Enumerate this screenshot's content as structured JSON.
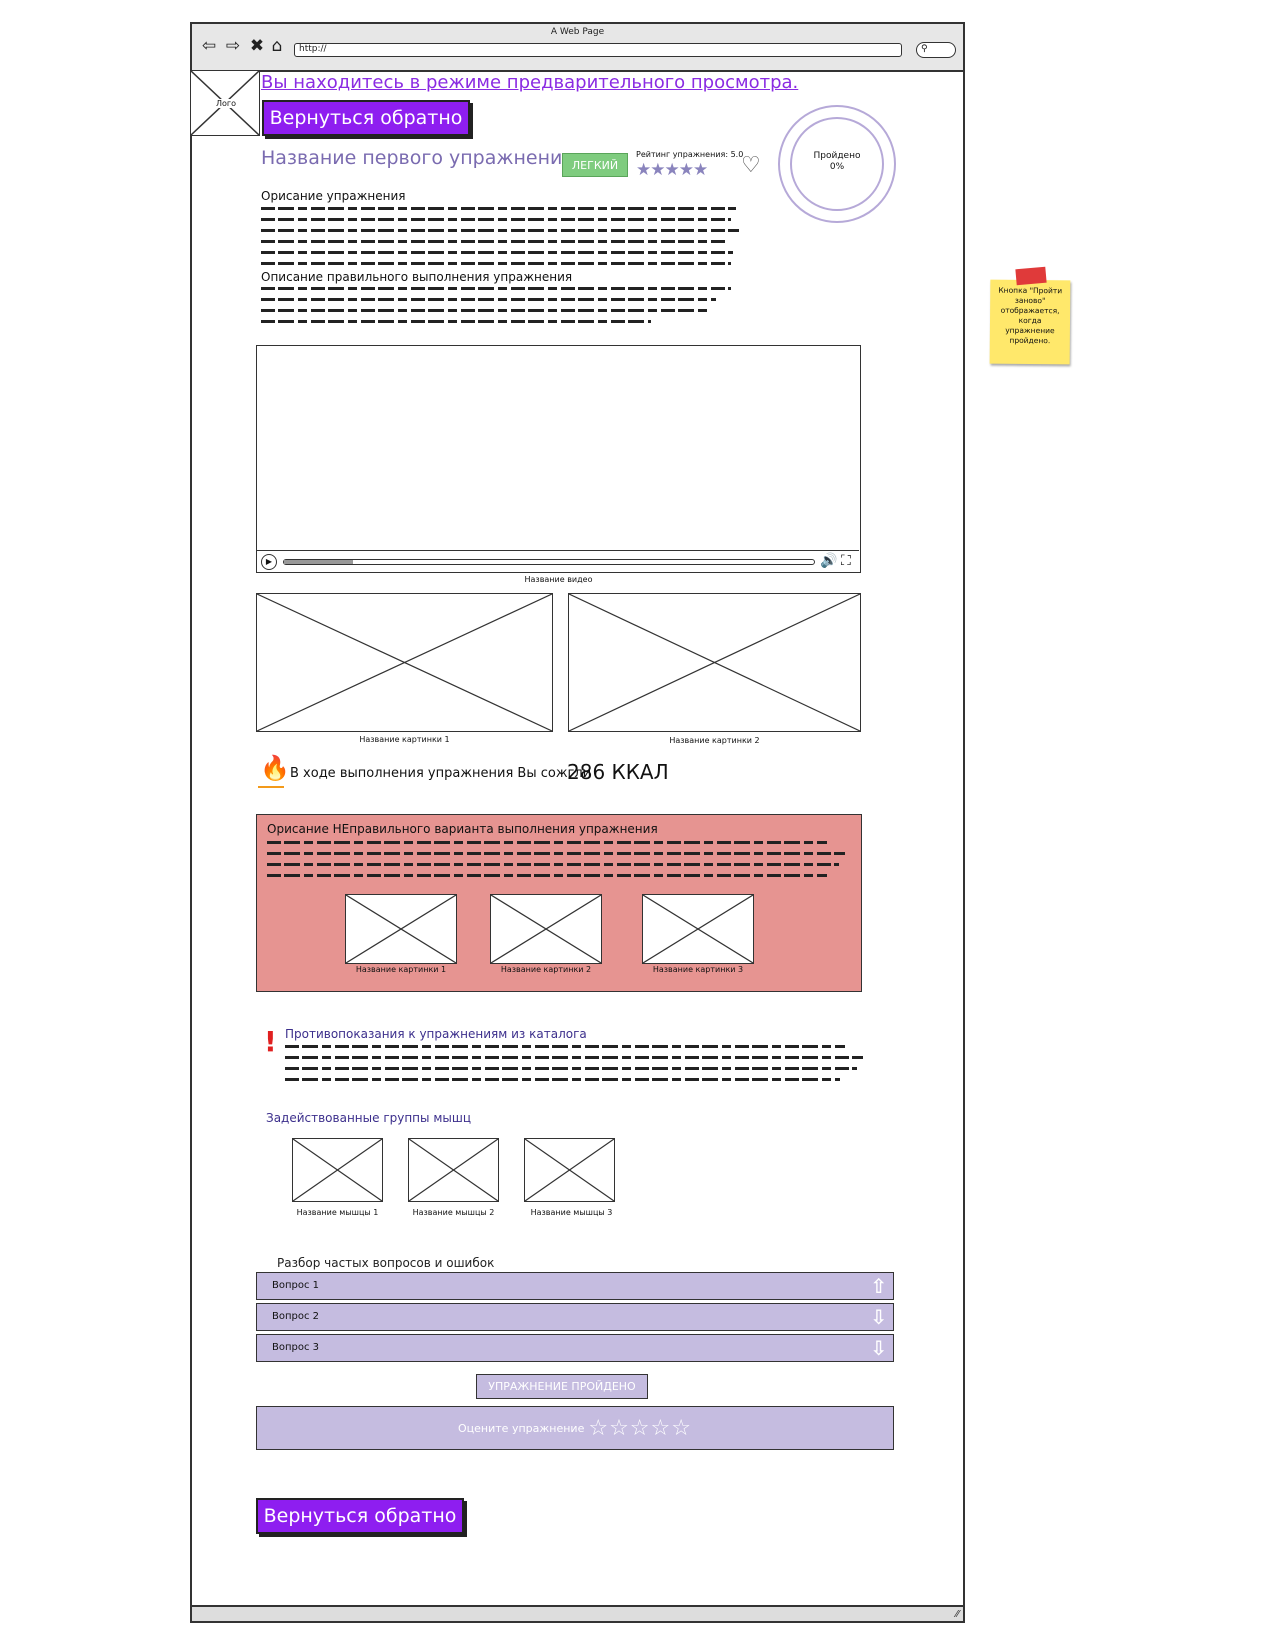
{
  "window": {
    "title": "A Web Page",
    "url": "http://"
  },
  "logo": {
    "label": "Лого"
  },
  "preview": {
    "link": "Вы находитесь в режиме предварительного просмотра.",
    "back_button": "Вернуться обратно"
  },
  "exercise": {
    "title": "Название первого упражнения",
    "difficulty": "ЛЕГКИЙ",
    "rating_label": "Рейтинг упражнения: 5.0",
    "rating_value": 5.0,
    "rating_stars": "★★★★★",
    "progress_label": "Пройдено",
    "progress_value": "0%"
  },
  "description": {
    "title": "Орисание упражнения",
    "correct_title": "Описание правильного выполнения упражнения"
  },
  "video": {
    "caption": "Название видео",
    "progress": 0.13
  },
  "images": [
    {
      "caption": "Название картинки 1"
    },
    {
      "caption": "Название картинки 2"
    }
  ],
  "calories": {
    "text": "В ходе выполнения упражнения Вы сожгли",
    "value": "286 ККАЛ"
  },
  "wrong": {
    "title": "Орисание НЕправильного варианта выполнения упражнения",
    "images": [
      {
        "caption": "Название картинки 1"
      },
      {
        "caption": "Название картинки 2"
      },
      {
        "caption": "Название картинки 3"
      }
    ]
  },
  "contraindications": {
    "title": "Противопоказания к упражнениям из каталога"
  },
  "muscles": {
    "title": "Задействованные группы мышц",
    "items": [
      {
        "caption": "Название мышцы 1"
      },
      {
        "caption": "Название мышцы 2"
      },
      {
        "caption": "Название мышцы 3"
      }
    ]
  },
  "faq": {
    "title": "Разбор частых вопросов и ошибок",
    "items": [
      {
        "label": "Вопрос 1",
        "arrow": "⇧"
      },
      {
        "label": "Вопрос 2",
        "arrow": "⇩"
      },
      {
        "label": "Вопрос 3",
        "arrow": "⇩"
      }
    ]
  },
  "done_button": "УПРАЖНЕНИЕ ПРОЙДЕНО",
  "rate": {
    "label": "Оцените упражнение",
    "stars": "☆☆☆☆☆"
  },
  "bottom_back_button": "Вернуться обратно",
  "note": {
    "text": "Кнопка \"Пройти заново\" отображается, когда упражнение пройдено."
  },
  "colors": {
    "accent": "#8e1ef0",
    "lavender": "#c5bce0",
    "wrong_bg": "#e69491",
    "easy": "#7fcc7f"
  }
}
